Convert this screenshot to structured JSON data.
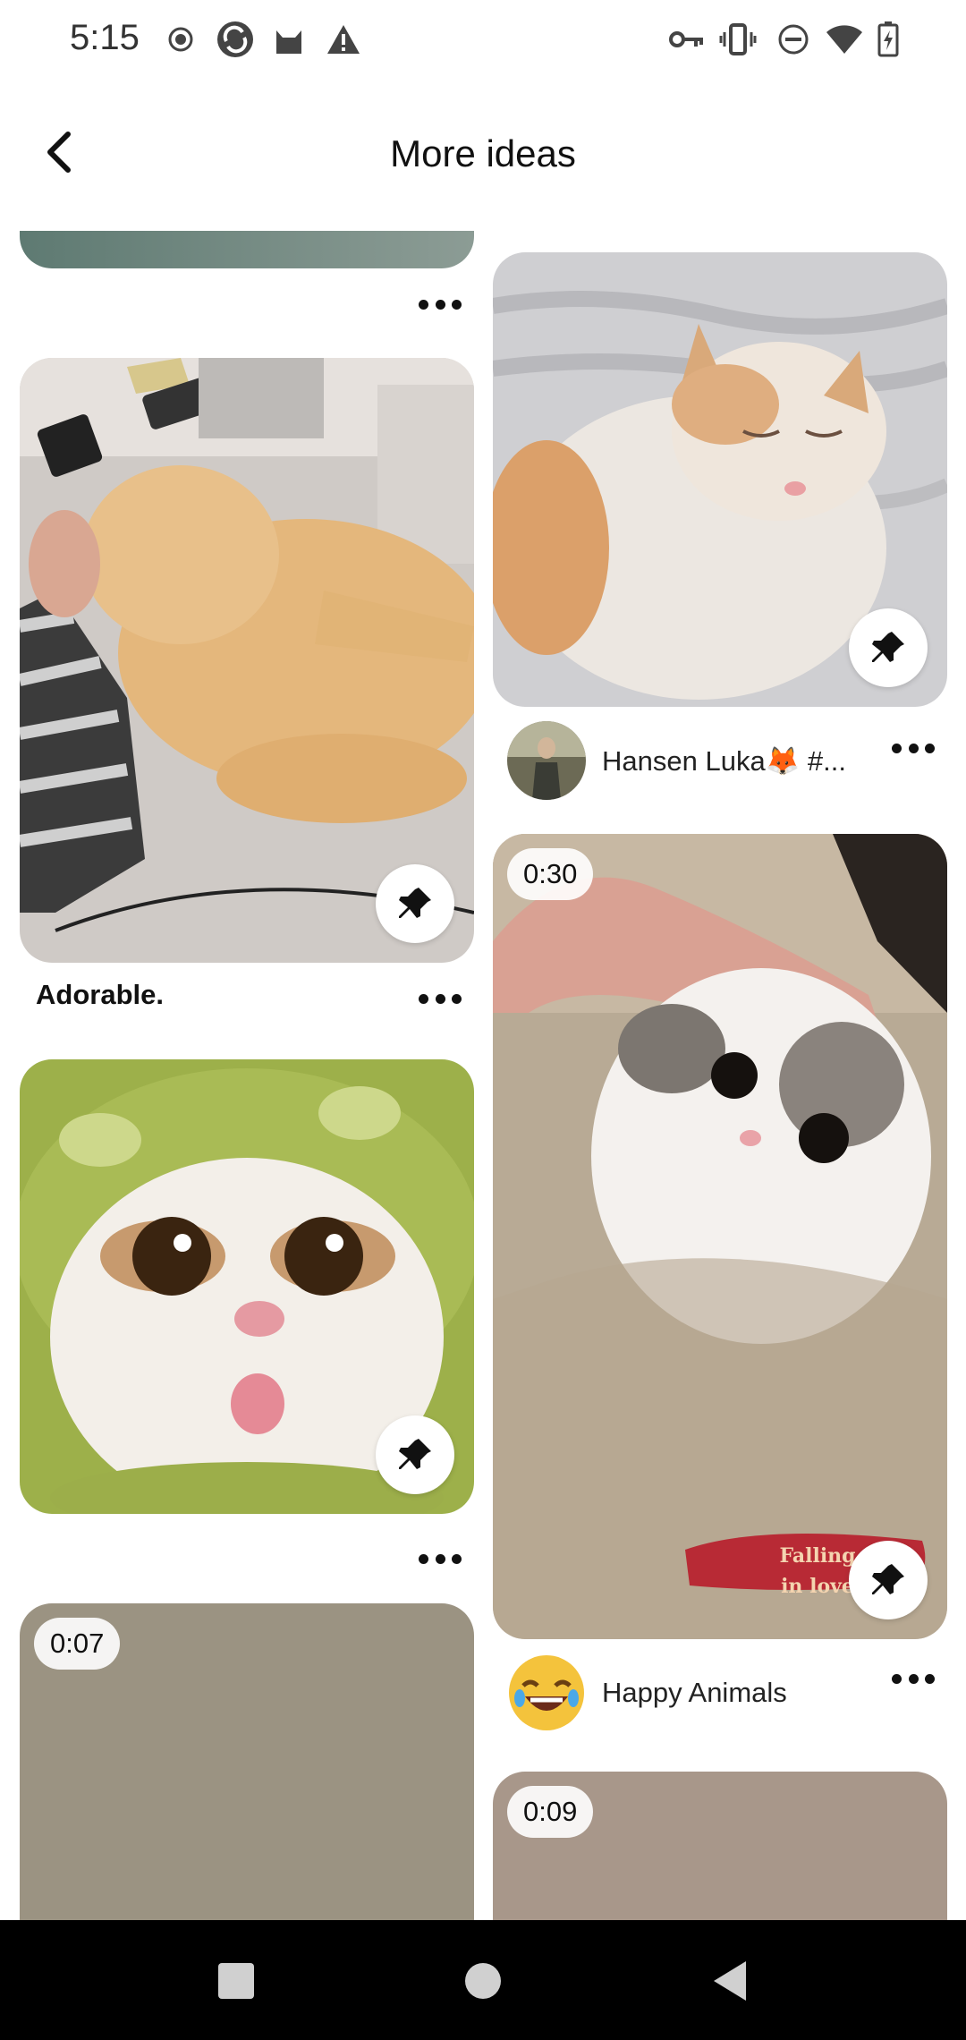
{
  "status_bar": {
    "time": "5:15",
    "left_icons": [
      "record-icon",
      "sync-app-icon",
      "cat-app-icon",
      "warning-icon"
    ],
    "right_icons": [
      "vpn-key-icon",
      "vibrate-icon",
      "do-not-disturb-icon",
      "wifi-icon",
      "battery-charging-icon"
    ]
  },
  "header": {
    "title": "More ideas",
    "back_icon": "chevron-left-icon"
  },
  "pins": {
    "left": [
      {
        "image": "teal-textured-photo",
        "title": ""
      },
      {
        "image": "orange-cat-lying-photo",
        "title": "Adorable."
      },
      {
        "image": "cat-in-frog-hat-photo",
        "title": ""
      },
      {
        "image": "video-thumbnail",
        "duration": "0:07"
      }
    ],
    "right": [
      {
        "image": "sleeping-kitten-photo",
        "author": "Hansen Luka🦊 #..."
      },
      {
        "image": "kitten-on-carpet-photo",
        "duration": "0:30",
        "overlay_text": "Falling in love",
        "author": "Happy Animals"
      },
      {
        "image": "video-thumbnail",
        "duration": "0:09"
      }
    ]
  },
  "actions": {
    "more": "more-options-icon",
    "save": "pin-icon"
  },
  "nav": {
    "icons": [
      "recents-square-icon",
      "home-circle-icon",
      "back-triangle-icon"
    ]
  },
  "colors": {
    "background": "#ffffff",
    "text": "#111111",
    "nav_bar": "#000000",
    "video_left": "#9b9382",
    "video_right": "#a8978a"
  }
}
